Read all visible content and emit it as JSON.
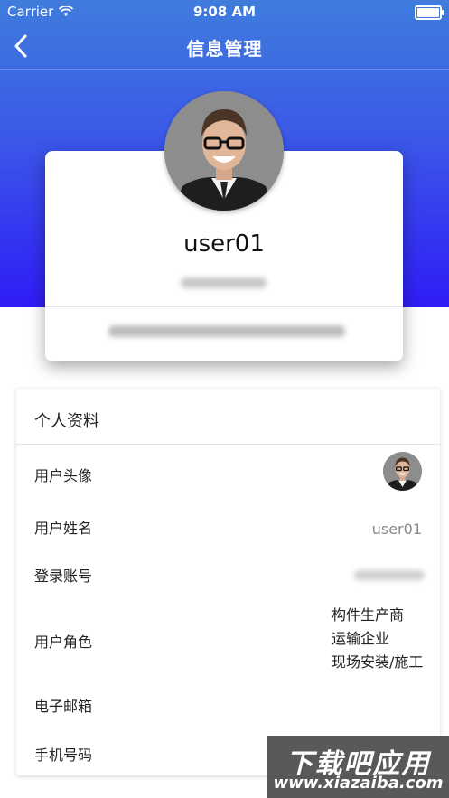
{
  "status_bar": {
    "carrier": "Carrier",
    "time": "9:08 AM"
  },
  "navbar": {
    "title": "信息管理"
  },
  "profile_card": {
    "username": "user01"
  },
  "profile_section": {
    "title": "个人资料",
    "rows": {
      "avatar_label": "用户头像",
      "name_label": "用户姓名",
      "name_value": "user01",
      "account_label": "登录账号",
      "role_label": "用户角色",
      "roles": [
        "构件生产商",
        "运输企业",
        "现场安装/施工"
      ],
      "email_label": "电子邮箱",
      "phone_label": "手机号码"
    }
  },
  "watermark": {
    "line1": "下载吧应用",
    "line2": "www.xiazaiba.com"
  },
  "colors": {
    "gradient_top": "#3f7cdc",
    "gradient_bottom": "#2f1cf6",
    "panel_bg": "#ffffff"
  }
}
